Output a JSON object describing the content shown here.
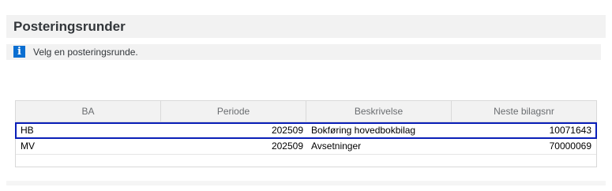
{
  "header": {
    "title": "Posteringsrunder"
  },
  "message": {
    "icon": "info-icon",
    "icon_glyph": "i",
    "text": "Velg en posteringsrunde."
  },
  "table": {
    "columns": [
      "BA",
      "Periode",
      "Beskrivelse",
      "Neste bilagsnr"
    ],
    "rows": [
      {
        "ba": "HB",
        "periode": "202509",
        "beskrivelse": "Bokføring hovedbokbilag",
        "neste_bilagsnr": "10071643",
        "selected": true
      },
      {
        "ba": "MV",
        "periode": "202509",
        "beskrivelse": "Avsetninger",
        "neste_bilagsnr": "70000069",
        "selected": false
      }
    ]
  },
  "colors": {
    "accent": "#0a6ed1",
    "selection_outline": "#0a1fb8",
    "header_bg": "#f2f2f2"
  }
}
